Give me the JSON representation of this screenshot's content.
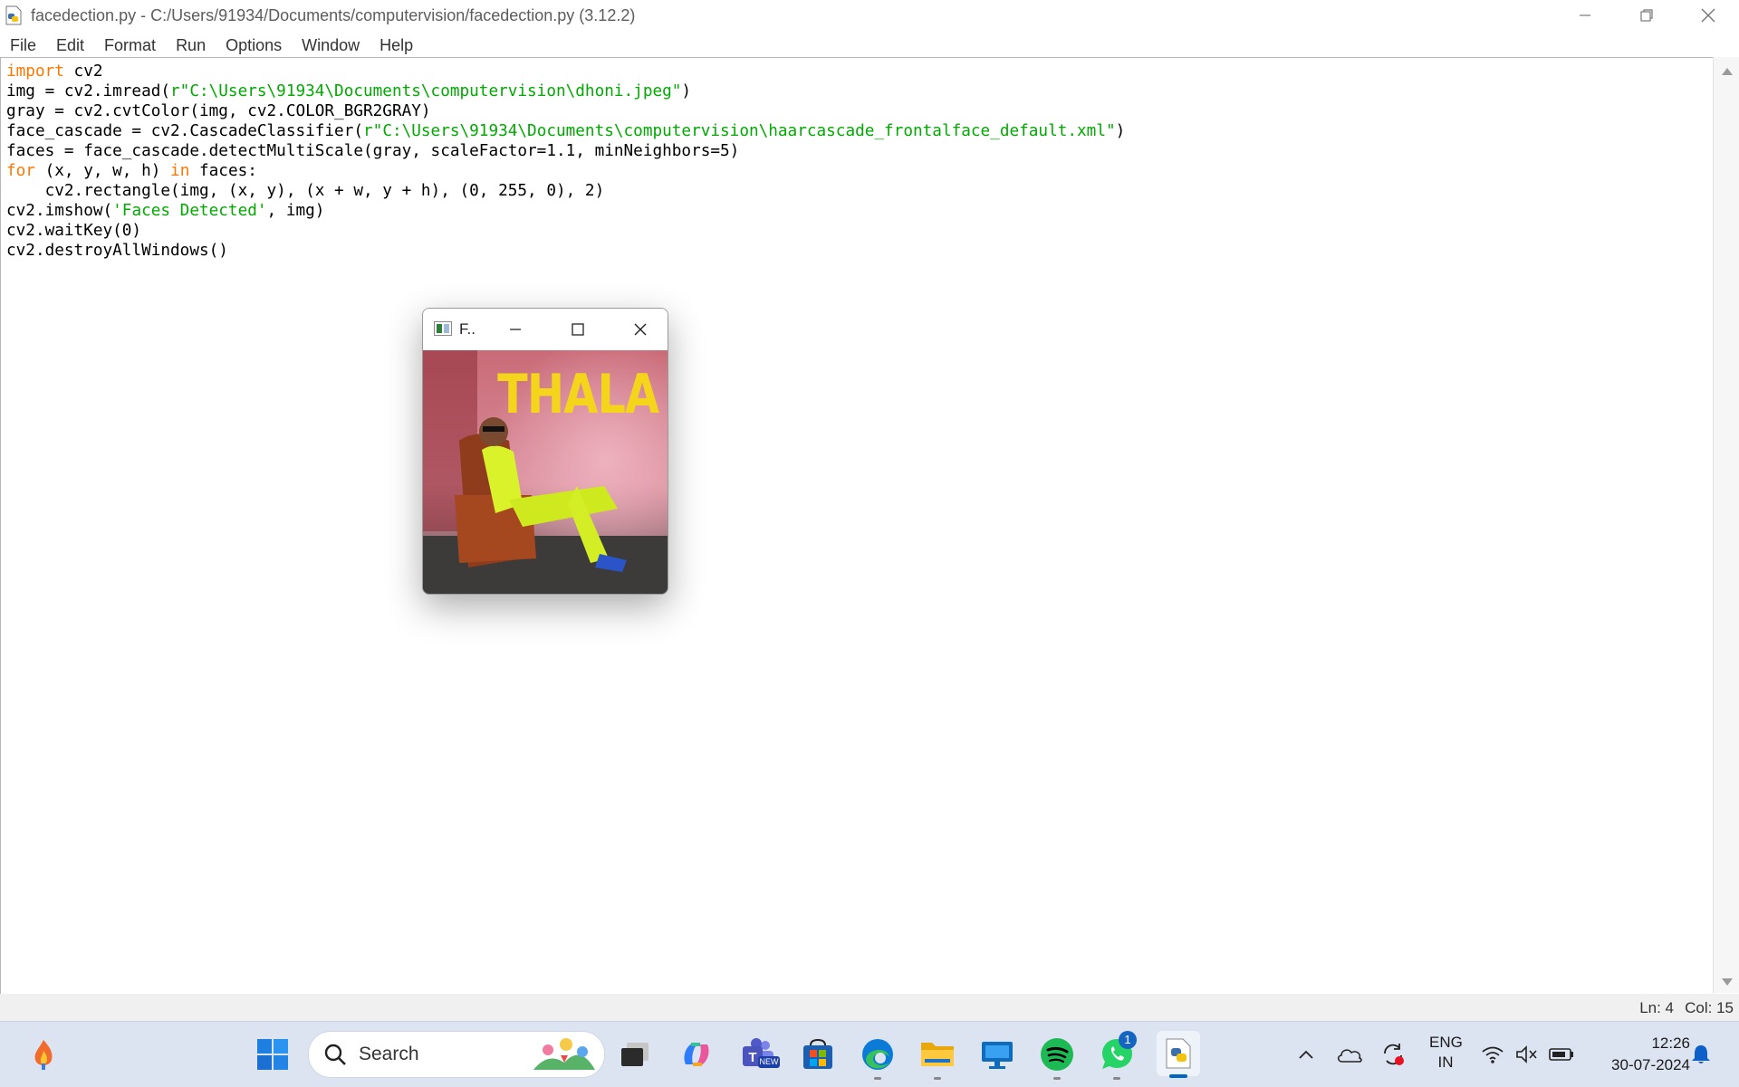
{
  "window": {
    "title": "facedection.py - C:/Users/91934/Documents/computervision/facedection.py (3.12.2)",
    "controls": {
      "minimize": "—",
      "restore": "❐",
      "close": "✕"
    }
  },
  "menu": [
    "File",
    "Edit",
    "Format",
    "Run",
    "Options",
    "Window",
    "Help"
  ],
  "code_lines": [
    [
      {
        "t": "import",
        "c": "kw"
      },
      {
        "t": " cv2"
      }
    ],
    [
      {
        "t": "img = cv2.imread("
      },
      {
        "t": "r\"C:\\Users\\91934\\Documents\\computervision\\dhoni.jpeg\"",
        "c": "str"
      },
      {
        "t": ")"
      }
    ],
    [
      {
        "t": "gray = cv2.cvtColor(img, cv2.COLOR_BGR2GRAY)"
      }
    ],
    [
      {
        "t": "face_cascade = cv2.CascadeClassifier("
      },
      {
        "t": "r\"C:\\Users\\91934\\Documents\\computervision\\haarcascade_frontalface_default.xml\"",
        "c": "str"
      },
      {
        "t": ")"
      }
    ],
    [
      {
        "t": "faces = face_cascade.detectMultiScale(gray, scaleFactor=1.1, minNeighbors=5)"
      }
    ],
    [
      {
        "t": "for",
        "c": "kw"
      },
      {
        "t": " (x, y, w, h) "
      },
      {
        "t": "in",
        "c": "kw"
      },
      {
        "t": " faces:"
      }
    ],
    [
      {
        "t": "    cv2.rectangle(img, (x, y), (x + w, y + h), (0, 255, 0), 2)"
      }
    ],
    [
      {
        "t": "cv2.imshow("
      },
      {
        "t": "'Faces Detected'",
        "c": "str"
      },
      {
        "t": ", img)"
      }
    ],
    [
      {
        "t": "cv2.waitKey(0)"
      }
    ],
    [
      {
        "t": "cv2.destroyAllWindows()"
      }
    ]
  ],
  "status": {
    "line": "Ln: 4",
    "col": "Col: 15"
  },
  "image_window": {
    "title": "F..",
    "image_text": "THALA"
  },
  "taskbar": {
    "search_label": "Search",
    "apps": [
      "widgets-icon",
      "start-icon",
      "task-view-icon",
      "copilot-icon",
      "teams-icon",
      "store-icon",
      "edge-icon",
      "file-explorer-icon",
      "remote-desktop-icon",
      "spotify-icon",
      "whatsapp-icon",
      "python-idle-icon"
    ],
    "teams_badge": "NEW",
    "whatsapp_badge": "1",
    "tray": {
      "lang_top": "ENG",
      "lang_bottom": "IN",
      "time": "12:26",
      "date": "30-07-2024"
    }
  }
}
